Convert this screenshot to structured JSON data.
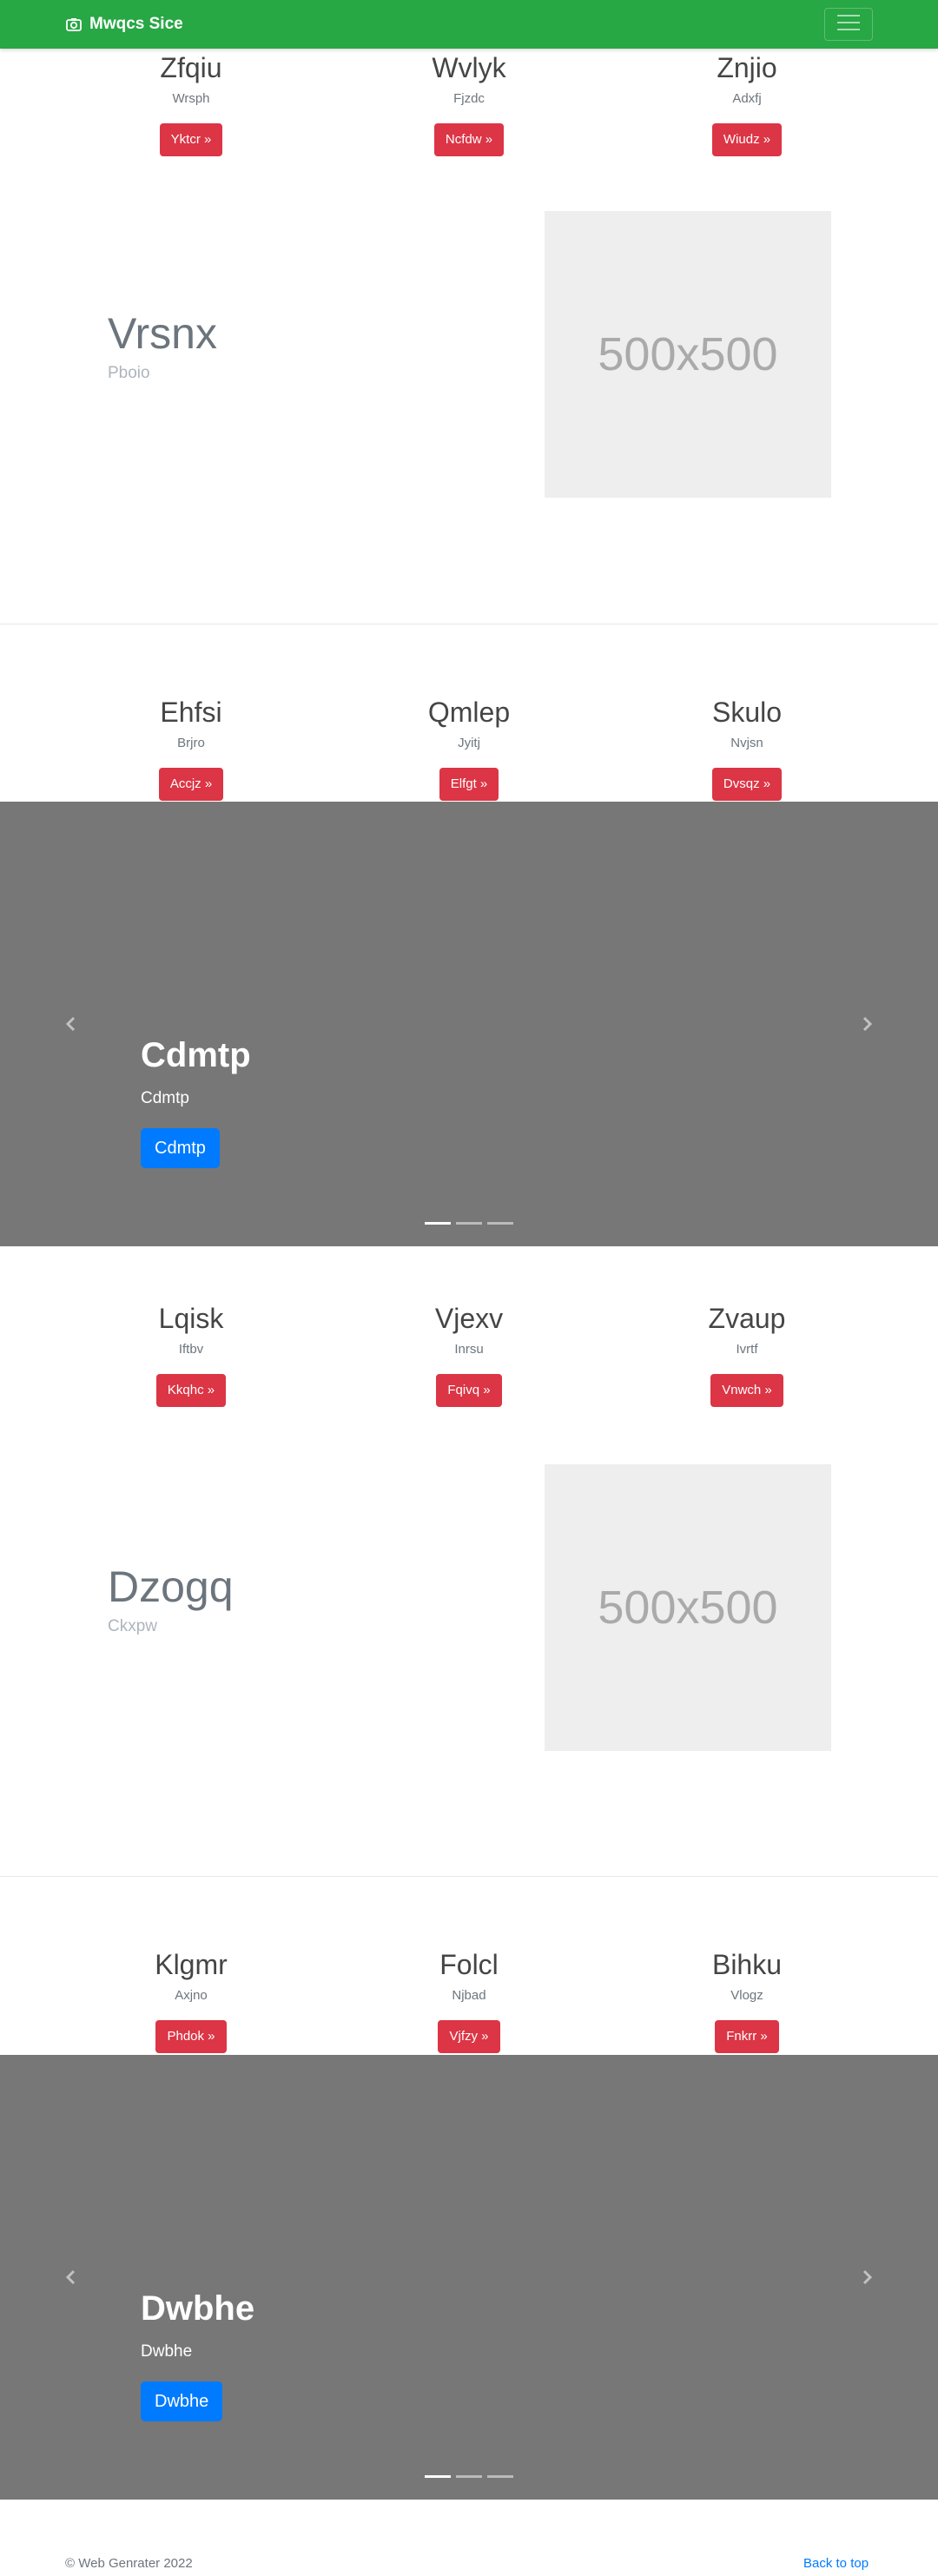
{
  "navbar": {
    "brand": "Mwqcs Sice",
    "brand_icon": "camera-icon",
    "toggler_icon": "hamburger-icon",
    "background": "#28a745"
  },
  "features_1": [
    {
      "title": "Zfqiu",
      "text": "Wrsph",
      "button": "Yktcr »"
    },
    {
      "title": "Wvlyk",
      "text": "Fjzdc",
      "button": "Ncfdw »"
    },
    {
      "title": "Znjio",
      "text": "Adxfj",
      "button": "Wiudz »"
    }
  ],
  "hero_1": {
    "title": "Vrsnx",
    "subtitle": "Pboio",
    "image_label": "500x500"
  },
  "features_2": [
    {
      "title": "Ehfsi",
      "text": "Brjro",
      "button": "Accjz »"
    },
    {
      "title": "Qmlep",
      "text": "Jyitj",
      "button": "Elfgt »"
    },
    {
      "title": "Skulo",
      "text": "Nvjsn",
      "button": "Dvsqz »"
    }
  ],
  "carousel_1": {
    "title": "Cdmtp",
    "subtitle": "Cdmtp",
    "button": "Cdmtp",
    "slide_count": 3,
    "active_slide": 1
  },
  "features_3": [
    {
      "title": "Lqisk",
      "text": "Iftbv",
      "button": "Kkqhc »"
    },
    {
      "title": "Vjexv",
      "text": "Inrsu",
      "button": "Fqivq »"
    },
    {
      "title": "Zvaup",
      "text": "Ivrtf",
      "button": "Vnwch »"
    }
  ],
  "hero_2": {
    "title": "Dzogq",
    "subtitle": "Ckxpw",
    "image_label": "500x500"
  },
  "features_4": [
    {
      "title": "Klgmr",
      "text": "Axjno",
      "button": "Phdok »"
    },
    {
      "title": "Folcl",
      "text": "Njbad",
      "button": "Vjfzy »"
    },
    {
      "title": "Bihku",
      "text": "Vlogz",
      "button": "Fnkrr »"
    }
  ],
  "carousel_2": {
    "title": "Dwbhe",
    "subtitle": "Dwbhe",
    "button": "Dwbhe",
    "slide_count": 3,
    "active_slide": 1
  },
  "footer": {
    "copyright": "© Web Genrater 2022",
    "back_to_top": "Back to top"
  },
  "colors": {
    "accent_button": "#dc3545",
    "primary_button": "#007bff",
    "carousel_bg": "#777777"
  }
}
